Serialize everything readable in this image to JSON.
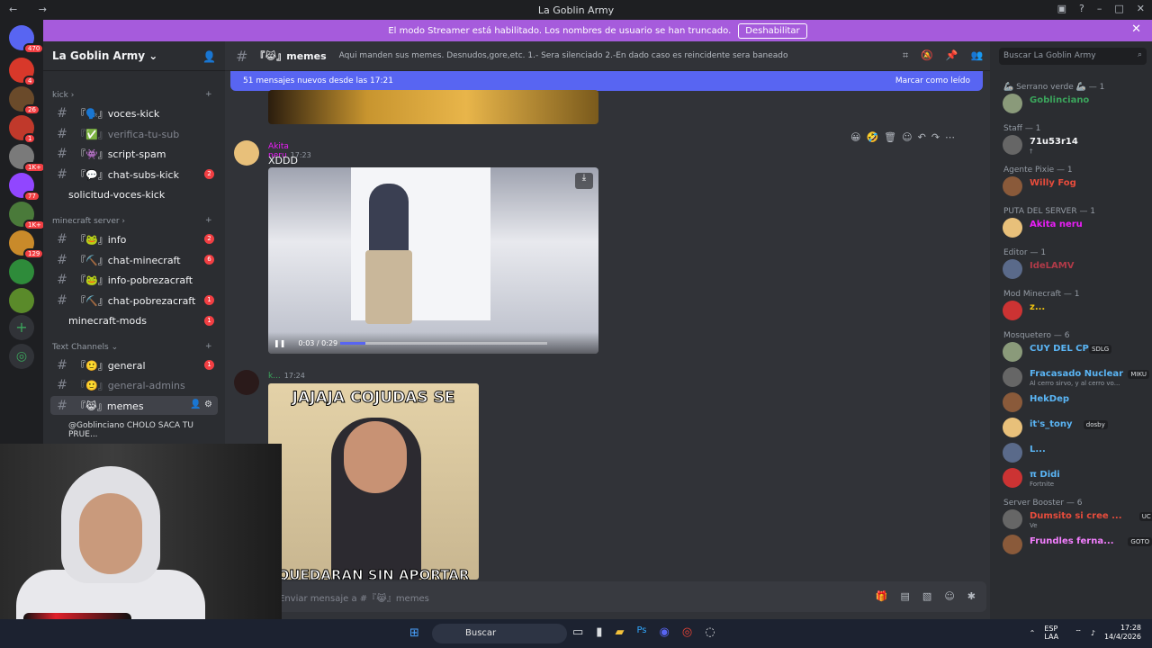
{
  "window": {
    "title": "La Goblin Army",
    "nav": "← →"
  },
  "banner": {
    "text": "El modo Streamer está habilitado. Los nombres de usuario se han truncado.",
    "button": "Deshabilitar",
    "close": "✕"
  },
  "guild_badges": [
    "470",
    "4",
    "26",
    "1",
    "1K+",
    "77",
    "1K+",
    "129"
  ],
  "server": {
    "name": "La Goblin Army"
  },
  "categories": {
    "kick": "kick",
    "minecraft": "minecraft server",
    "text": "Text Channels"
  },
  "channels": {
    "voces_kick": "『🗣️』voces-kick",
    "verifica": "『✅』verifica-tu-sub",
    "script_spam": "『👾』script-spam",
    "chat_subs": "『💬』chat-subs-kick",
    "chat_subs_badge": "2",
    "solicitud": "solicitud-voces-kick",
    "info": "『🐸』info",
    "info_badge": "2",
    "chat_minecraft": "『⛏️』chat-minecraft",
    "chat_minecraft_badge": "6",
    "info_pobreza": "『🐸』info-pobrezacraft",
    "chat_pobreza": "『⛏️』chat-pobrezacraft",
    "chat_pobreza_badge": "1",
    "mods": "minecraft-mods",
    "mods_badge": "1",
    "general": "『🙂』general",
    "general_badge": "1",
    "general_admins": "『🙂』general-admins",
    "memes": "『😹』memes",
    "thread": "@Goblinciano CHOLO SACA TU PRUE..."
  },
  "header": {
    "channel": "『😹』memes",
    "topic": "Aqui manden sus memes. Desnudos,gore,etc. 1.- Sera silenciado 2.-En dado caso es reincidente sera baneado",
    "search": "Buscar La Goblin Army"
  },
  "newbar": {
    "text": "51 mensajes nuevos desde las 17:21",
    "action": "Marcar como leído"
  },
  "messages": [
    {
      "user": "Akita neru",
      "time": "17:23",
      "text": "XDDD",
      "video_time": "0:03 / 0:29",
      "progress": 0.12
    },
    {
      "user": "k...",
      "time": "17:24",
      "meme_top": "JAJAJA COJUDAS SE",
      "meme_bottom": "QUEDARAN SIN APORTAR"
    }
  ],
  "composer": {
    "placeholder": "Enviar mensaje a #『😹』memes"
  },
  "members": {
    "groups": [
      {
        "label": "🦾 Serrano verde 🦾 — 1",
        "items": [
          {
            "name": "Goblinciano",
            "color": "#3ba55c"
          }
        ]
      },
      {
        "label": "Staff — 1",
        "items": [
          {
            "name": "71u53r14",
            "color": "#f2f3f5",
            "status": "†"
          }
        ]
      },
      {
        "label": "Agente Pixie — 1",
        "items": [
          {
            "name": "Willy Fog",
            "color": "#e74c3c"
          }
        ]
      },
      {
        "label": "PUTA DEL SERVER — 1",
        "items": [
          {
            "name": "Akita neru",
            "color": "#e91ef7"
          }
        ]
      },
      {
        "label": "Editor — 1",
        "items": [
          {
            "name": "IdeLAMV",
            "color": "#b03a48"
          }
        ]
      },
      {
        "label": "Mod Minecraft — 1",
        "items": [
          {
            "name": "z...",
            "color": "#f1c40f"
          }
        ]
      },
      {
        "label": "Mosquetero — 6",
        "items": [
          {
            "name": "CUY DEL CP",
            "color": "#5ab5f5",
            "tag": "SDLG"
          },
          {
            "name": "Fracasado Nuclear",
            "color": "#5ab5f5",
            "tag": "MIKU",
            "status": "Al cerro sirvo, y al cerro vo..."
          },
          {
            "name": "HekDep",
            "color": "#5ab5f5"
          },
          {
            "name": "it's_tony",
            "color": "#5ab5f5",
            "tag": "dosby"
          },
          {
            "name": "L...",
            "color": "#5ab5f5"
          },
          {
            "name": "π Didi",
            "color": "#5ab5f5",
            "status": "Fortnite"
          }
        ]
      },
      {
        "label": "Server Booster — 6",
        "items": [
          {
            "name": "Dumsito si cree ...",
            "color": "#e74c3c",
            "tag": "UC",
            "status": "Ve"
          },
          {
            "name": "Frundles ferna...",
            "color": "#f47fff",
            "tag": "GOTO"
          }
        ]
      }
    ]
  },
  "taskbar": {
    "search": "Buscar",
    "lang": "ESP LAA",
    "time": "17:28",
    "date": "14/4/2026"
  },
  "colors": {
    "accent": "#5865f2",
    "banner": "#a65bdc",
    "badge": "#f23f43"
  }
}
